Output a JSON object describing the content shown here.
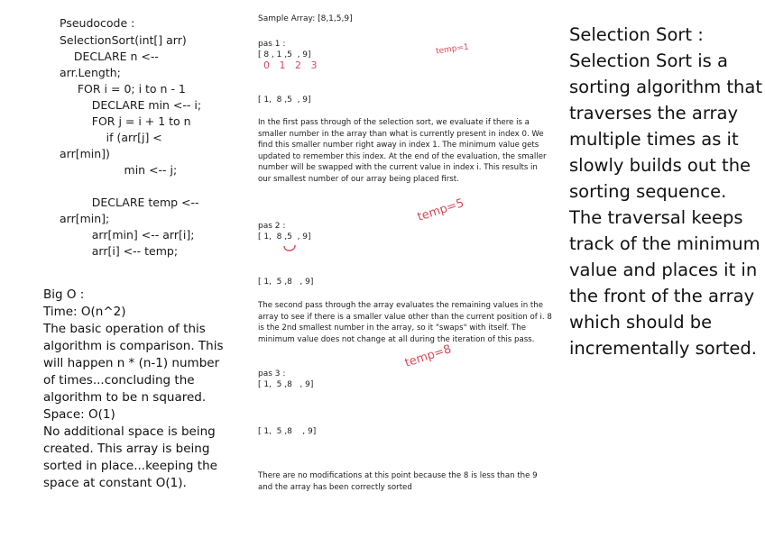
{
  "pseudocode": {
    "lines": [
      "Pseudocode :",
      "SelectionSort(int[] arr)",
      "    DECLARE n <--",
      "arr.Length;",
      "     FOR i = 0; i to n - 1",
      "         DECLARE min <-- i;",
      "         FOR j = i + 1 to n",
      "             if (arr[j] <",
      "arr[min])",
      "                  min <-- j;",
      "",
      "         DECLARE temp <--",
      "arr[min];",
      "         arr[min] <-- arr[i];",
      "         arr[i] <-- temp;"
    ]
  },
  "big_o": {
    "heading": "Big O :",
    "time": "Time: O(n^2)",
    "time_explanation": "The basic operation of this algorithm is comparison. This will happen n * (n-1) number of times...concluding the algorithm to be n squared.",
    "space": "Space: O(1)",
    "space_explanation": "No additional space is being created. This array is being sorted in place...keeping the space at constant O(1)."
  },
  "walkthrough": {
    "sample": "Sample Array: [8,1,5,9]",
    "pass1_label": "pas 1 :",
    "pass1_before": "[ 8 , 1 ,5  , 9]",
    "pass1_indices": "0   1   2   3",
    "pass1_temp": "temp=1",
    "pass1_after": "[ 1,  8 ,5  , 9]",
    "pass1_text": "In the first pass through of the selection sort, we evaluate if there is a smaller number in the array than what is currently present in index 0. We find this smaller number right away in index 1. The minimum value gets updated to remember this index. At the end of the evaluation, the smaller number will be swapped with the current value in index i. This results in our smallest number of our array being placed first.",
    "pass2_temp": "temp=5",
    "pass2_label": "pas 2 :",
    "pass2_before": "[ 1,  8 ,5  , 9]",
    "pass2_after": "[ 1,  5 ,8   , 9]",
    "pass2_text": "The second pass through the array evaluates the remaining values in the array to see if there is a smaller value other than the current position of i. 8 is the 2nd smallest number in the array, so it \"swaps\" with itself. The minimum value does not change at all during the iteration of this pass.",
    "pass3_temp": "temp=8",
    "pass3_label": "pas 3 :",
    "pass3_before": "[ 1,  5 ,8   , 9]",
    "pass3_after": "[ 1,  5 ,8    , 9]",
    "final_text": "There are no modifications at this point because the 8 is less than  the 9 and the array  has been correctly sorted"
  },
  "summary": {
    "text": "Selection Sort : Selection Sort is a sorting algorithm that traverses the array multiple times as it slowly builds out the sorting sequence. The traversal keeps track of the minimum value and places it in the front of the array which should be incrementally sorted."
  },
  "colors": {
    "ink": "#111111",
    "annotation": "#d94a5a"
  }
}
